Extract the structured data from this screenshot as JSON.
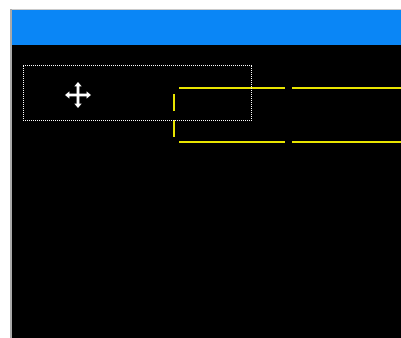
{
  "window": {
    "title": ""
  },
  "colors": {
    "title_bar": "#0a86f6",
    "canvas_background": "#000000",
    "guide_lines": "#e8e400",
    "selection_border": "#ffffff"
  },
  "canvas": {
    "selection": {
      "style": "dotted"
    },
    "cursor": {
      "icon": "move-cursor-icon"
    },
    "guides": {
      "style": "dashed",
      "color_name": "yellow"
    }
  }
}
